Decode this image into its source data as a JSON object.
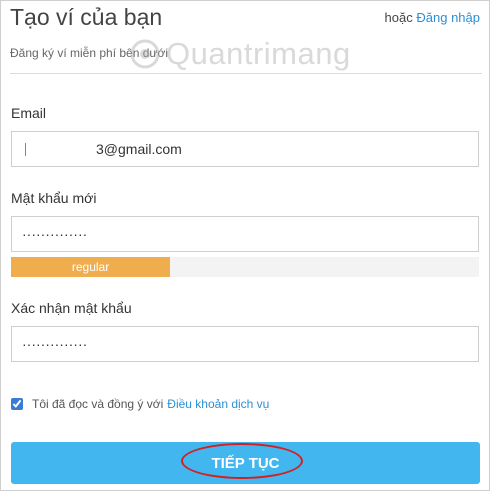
{
  "header": {
    "title": "Tạo ví của bạn",
    "or_text": "hoặc",
    "login_link": "Đăng nhập",
    "subtitle": "Đăng ký ví miễn phí bên dưới"
  },
  "watermark": {
    "text": "Quantrimang",
    "icon": "watermark-logo-icon"
  },
  "form": {
    "email": {
      "label": "Email",
      "value": "3@gmail.com"
    },
    "new_password": {
      "label": "Mật khẩu mới",
      "value": "··············"
    },
    "strength": {
      "label": "regular",
      "level_fraction": 0.34,
      "color": "#f0ad4e"
    },
    "confirm_password": {
      "label": "Xác nhận mật khẩu",
      "value": "··············"
    },
    "terms": {
      "checked": true,
      "text": "Tôi đã đọc và đồng ý với",
      "link": "Điều khoản dịch vụ"
    },
    "submit_label": "TIẾP TỤC"
  },
  "colors": {
    "accent": "#42b6ef",
    "link": "#2a8fd6",
    "highlight": "#d42020"
  }
}
